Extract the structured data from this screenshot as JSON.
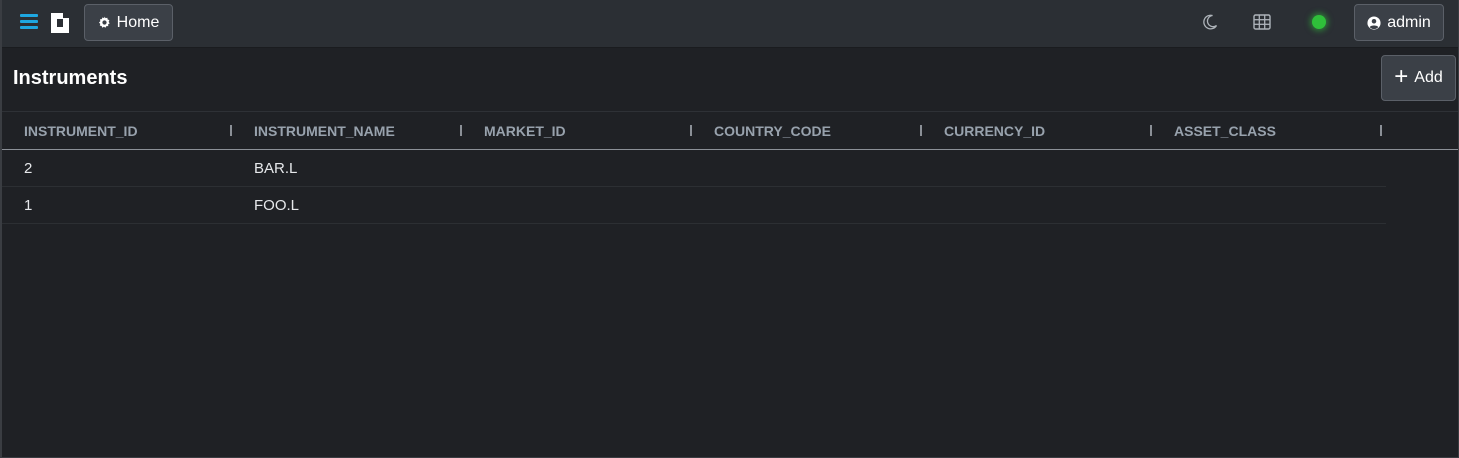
{
  "topbar": {
    "home_label": "Home",
    "user_label": "admin",
    "status_color": "#2fbf3a",
    "accent_color": "#1ea7e0"
  },
  "page": {
    "title": "Instruments",
    "add_label": "Add"
  },
  "table": {
    "columns": [
      "INSTRUMENT_ID",
      "INSTRUMENT_NAME",
      "MARKET_ID",
      "COUNTRY_CODE",
      "CURRENCY_ID",
      "ASSET_CLASS"
    ],
    "rows": [
      [
        "2",
        "BAR.L",
        "",
        "",
        "",
        ""
      ],
      [
        "1",
        "FOO.L",
        "",
        "",
        "",
        ""
      ]
    ]
  },
  "icons": {
    "menu": "menu-icon",
    "logo": "logo-icon",
    "home": "gear-icon",
    "theme": "moon-icon",
    "layout": "grid-icon",
    "user": "user-circle-icon",
    "add": "plus-icon"
  }
}
